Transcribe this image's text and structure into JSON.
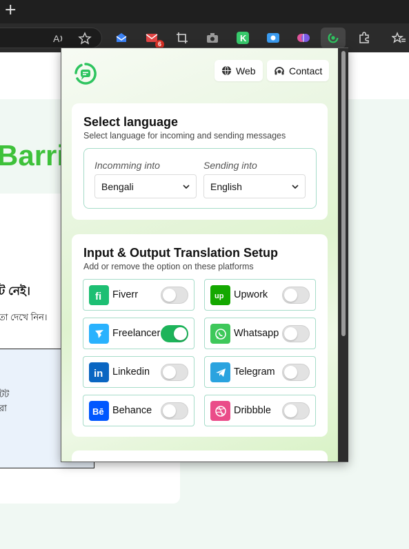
{
  "browser": {
    "new_tab": "+",
    "notification_badge": "6",
    "extension_icons": [
      "inbox-icon",
      "mail-icon",
      "screenshot-crop-icon",
      "camera-icon",
      "k-app-icon",
      "screen-record-icon",
      "brain-icon",
      "translator-extension-icon",
      "puzzle-icon",
      "favorites-icon"
    ]
  },
  "background_page": {
    "hero_text": "Barrie",
    "bengali_line1": "ট নেই।",
    "bengali_line2": "তা দেখে নিন।",
    "bengali_box_line1": "টট",
    "bengali_box_line2": "রা"
  },
  "popup": {
    "header": {
      "web_label": "Web",
      "contact_label": "Contact"
    },
    "language_card": {
      "title": "Select language",
      "subtitle": "Select language for incoming and sending messages",
      "incoming_label": "Incomming into",
      "incoming_value": "Bengali",
      "sending_label": "Sending into",
      "sending_value": "English"
    },
    "platform_card": {
      "title": "Input & Output Translation Setup",
      "subtitle": "Add or remove the option on these platforms",
      "platforms": [
        {
          "name": "Fiverr",
          "enabled": false,
          "color": "#1dbf73"
        },
        {
          "name": "Upwork",
          "enabled": false,
          "color": "#14a800"
        },
        {
          "name": "Freelancer",
          "enabled": true,
          "color": "#29b2fe"
        },
        {
          "name": "Whatsapp",
          "enabled": false,
          "color": "#3ec85a"
        },
        {
          "name": "Linkedin",
          "enabled": false,
          "color": "#0a66c2"
        },
        {
          "name": "Telegram",
          "enabled": false,
          "color": "#2aa3df"
        },
        {
          "name": "Behance",
          "enabled": false,
          "color": "#0057ff"
        },
        {
          "name": "Dribbble",
          "enabled": false,
          "color": "#ea4c89"
        }
      ]
    }
  },
  "colors": {
    "accent_green": "#1db45a",
    "border_teal": "#a6dcc9",
    "hero_green": "#3ec13a"
  }
}
